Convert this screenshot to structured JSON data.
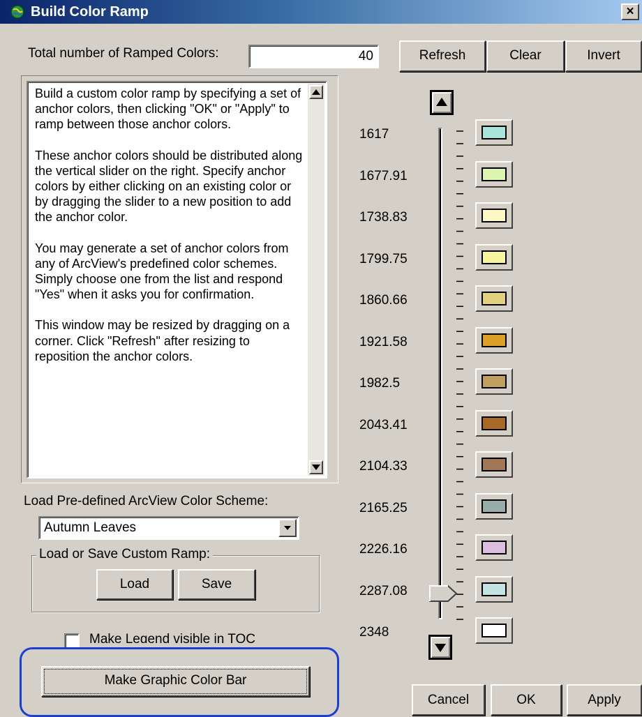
{
  "window": {
    "title": "Build Color Ramp",
    "close_label": "×"
  },
  "ramp_count": {
    "label": "Total number of Ramped Colors:",
    "value": "40"
  },
  "toolbar": {
    "refresh_label": "Refresh",
    "clear_label": "Clear",
    "invert_label": "Invert"
  },
  "help": {
    "paragraphs": [
      "Build a custom color ramp by specifying a set of anchor colors, then clicking \"OK\" or \"Apply\" to ramp between those anchor colors.",
      "These anchor colors should be distributed along the vertical slider on the right.  Specify anchor colors by either clicking on an existing color or by dragging the slider to a new position to add the anchor color.",
      "You may generate a set of anchor colors from any of ArcView's predefined color schemes.  Simply choose one from the list and respond \"Yes\" when it asks you for confirmation.",
      "This window may be resized by dragging on a corner.  Click \"Refresh\" after resizing to reposition the anchor colors."
    ]
  },
  "scheme": {
    "label": "Load Pre-defined ArcView Color Scheme:",
    "selected": "Autumn Leaves"
  },
  "custom_ramp": {
    "legend": "Load or Save Custom Ramp:",
    "load_label": "Load",
    "save_label": "Save"
  },
  "legend_toc": {
    "label": "Make Legend visible in TOC",
    "checked": false
  },
  "color_bar_button": {
    "label": "Make Graphic Color Bar"
  },
  "anchors": [
    {
      "value": "1617",
      "color": "#a8e6dc"
    },
    {
      "value": "1677.91",
      "color": "#dcf5b0"
    },
    {
      "value": "1738.83",
      "color": "#fdf8c4"
    },
    {
      "value": "1799.75",
      "color": "#f8f4a0"
    },
    {
      "value": "1860.66",
      "color": "#e0d080"
    },
    {
      "value": "1921.58",
      "color": "#dca028"
    },
    {
      "value": "1982.5",
      "color": "#c0a060"
    },
    {
      "value": "2043.41",
      "color": "#a86828"
    },
    {
      "value": "2104.33",
      "color": "#a07858"
    },
    {
      "value": "2165.25",
      "color": "#98aca8"
    },
    {
      "value": "2226.16",
      "color": "#dcbce0"
    },
    {
      "value": "2287.08",
      "color": "#c4e4e4"
    },
    {
      "value": "2348",
      "color": "#ffffff"
    }
  ],
  "footer": {
    "cancel_label": "Cancel",
    "ok_label": "OK",
    "apply_label": "Apply"
  },
  "highlight_color": "#0033cc"
}
